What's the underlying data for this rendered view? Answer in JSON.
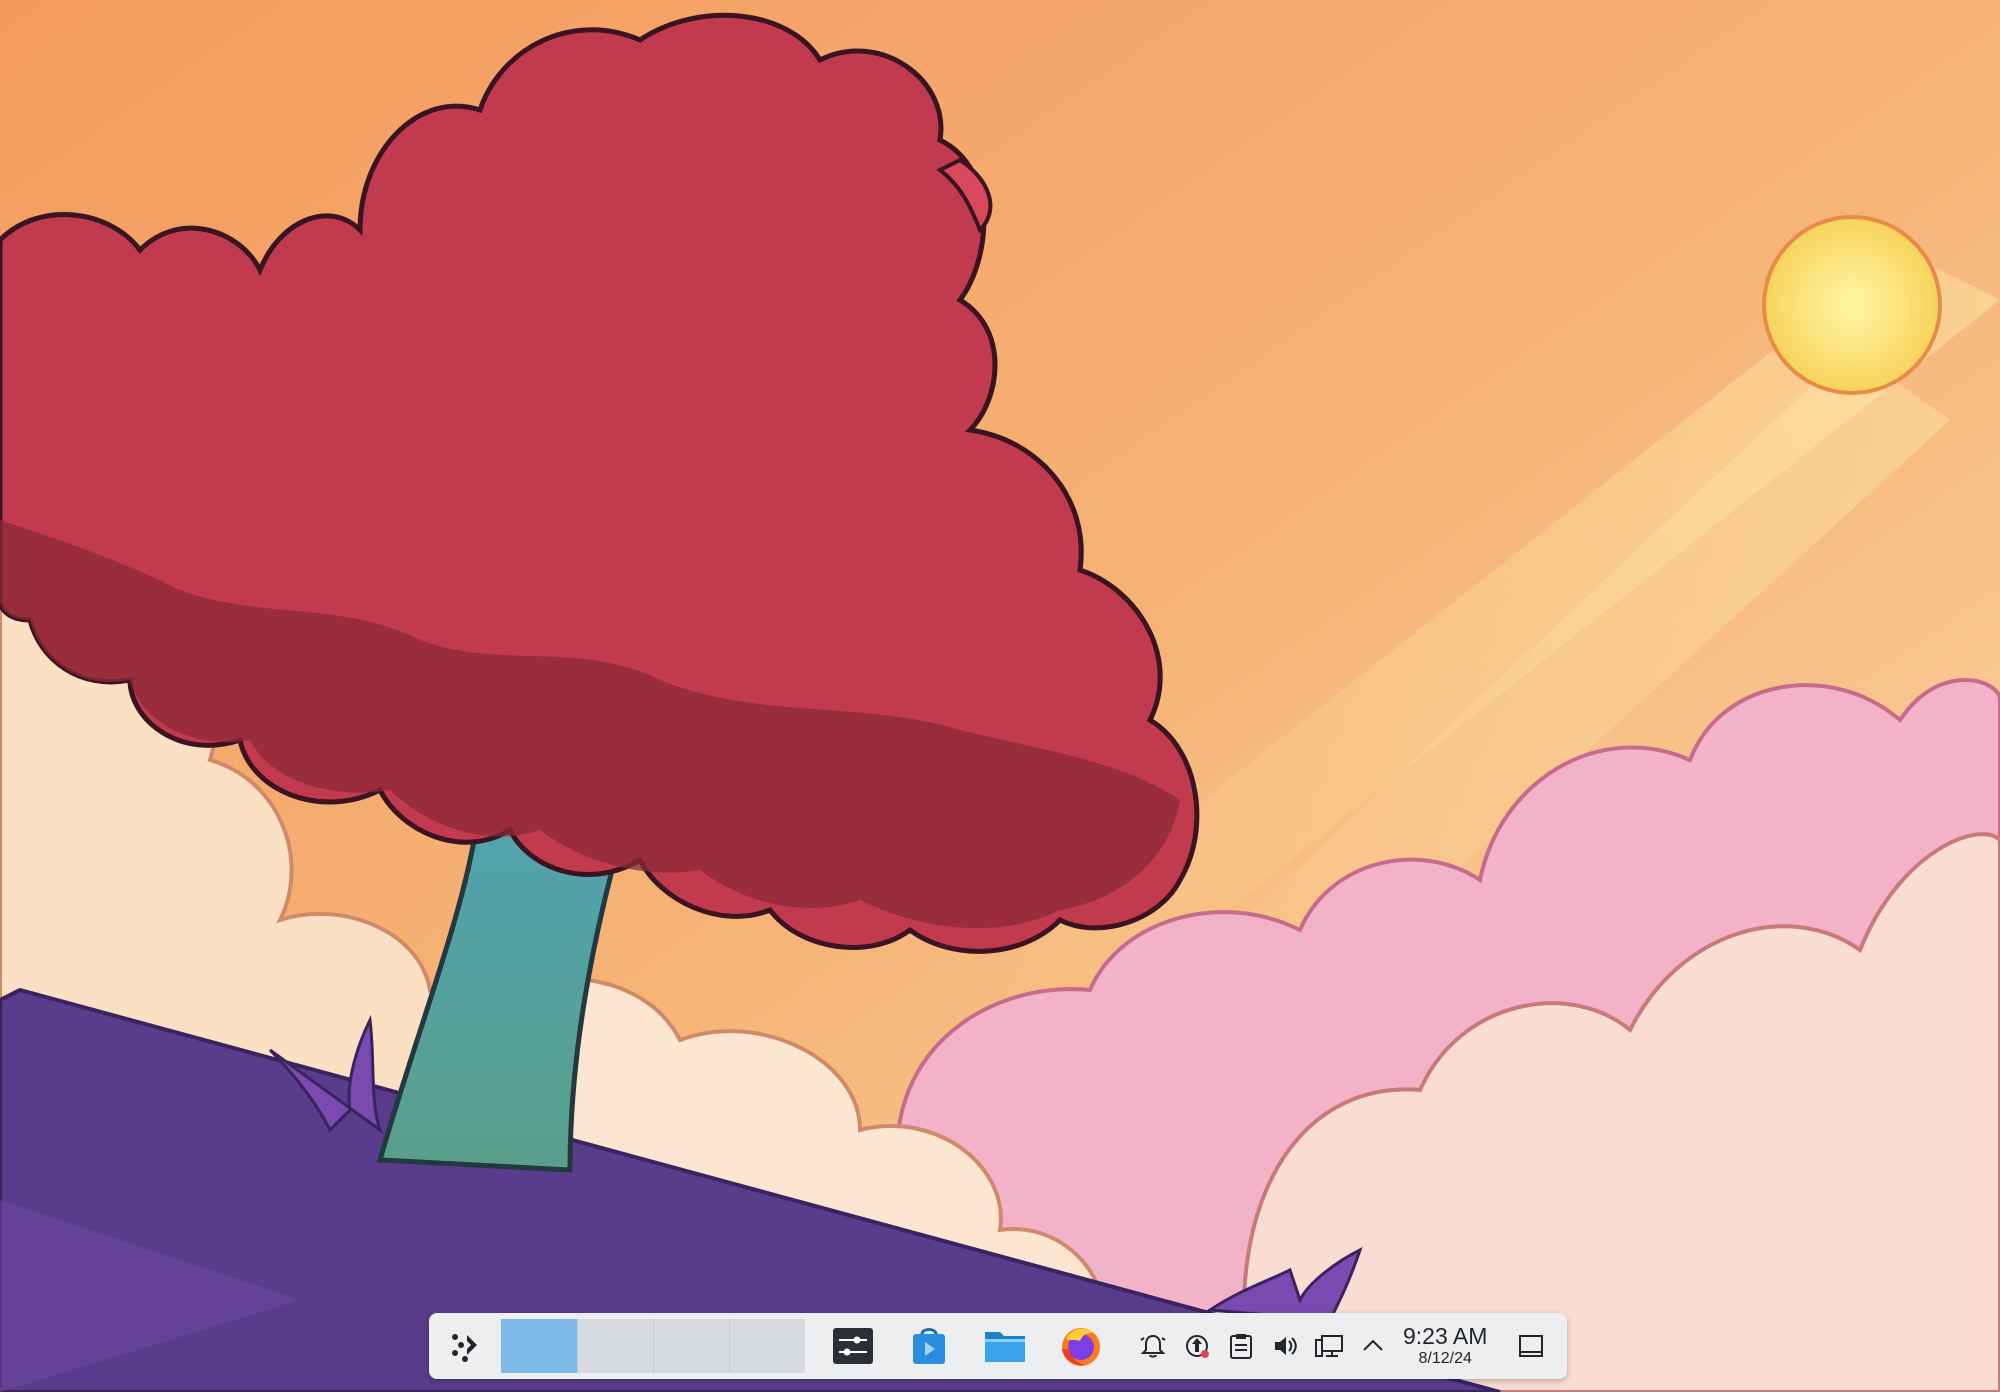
{
  "desktop": {
    "wallpaper": "tree-on-hill-sunset"
  },
  "taskbar": {
    "launcher_icon": "app-launcher-icon",
    "pager": {
      "desktops": [
        {
          "active": true
        },
        {
          "active": false
        },
        {
          "active": false
        },
        {
          "active": false
        }
      ]
    },
    "tasks": [
      {
        "icon": "system-settings-icon"
      },
      {
        "icon": "discover-store-icon"
      },
      {
        "icon": "dolphin-file-manager-icon"
      },
      {
        "icon": "firefox-icon"
      }
    ],
    "tray": [
      {
        "icon": "notifications-bell-icon"
      },
      {
        "icon": "updates-icon"
      },
      {
        "icon": "clipboard-icon"
      },
      {
        "icon": "volume-icon"
      },
      {
        "icon": "network-wired-icon"
      },
      {
        "icon": "chevron-up-icon"
      }
    ],
    "clock": {
      "time": "9:23 AM",
      "date": "8/12/24"
    },
    "show_desktop_icon": "show-desktop-icon"
  },
  "colors": {
    "panel_bg": "#eceef0",
    "pager_active": "#7fbbe9",
    "pager_inactive": "#d6d9de",
    "accent": "#3daee9"
  }
}
